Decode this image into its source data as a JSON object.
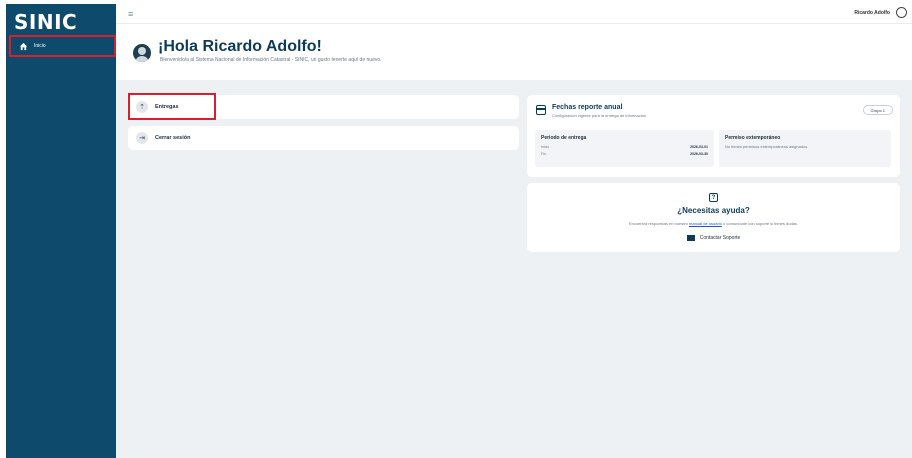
{
  "app": {
    "logo": "SINIC"
  },
  "sidebar": {
    "items": [
      {
        "label": "Inicio",
        "icon": "home-icon"
      }
    ]
  },
  "topbar": {
    "user_name": "Ricardo Adolfo"
  },
  "hero": {
    "greeting": "¡Hola Ricardo Adolfo!",
    "welcome": "Bienvenido/a al Sistema Nacional de Información Catastral - SINIC, un gusto tenerte aquí de nuevo."
  },
  "menu": {
    "items": [
      {
        "label": "Entregas",
        "icon": "upload-icon"
      },
      {
        "label": "Cerrar sesión",
        "icon": "logout-icon"
      }
    ]
  },
  "fechas": {
    "title": "Fechas reporte anual",
    "subtitle": "Configuración vigente para la entrega de información",
    "grupo_button": "Grupo 1",
    "periodo": {
      "title": "Periodo de entrega",
      "rows": [
        {
          "label": "Inicio",
          "value": "2026-03-01"
        },
        {
          "label": "Fin",
          "value": "2026-03-30"
        }
      ]
    },
    "permiso": {
      "title": "Permiso extemporáneo",
      "text": "No tienes permisos extemporáneos asignados."
    }
  },
  "ayuda": {
    "title": "¿Necesitas ayuda?",
    "text_before": "Encuentra respuestas en nuestro",
    "link": "manual de usuario",
    "text_after": "o comunícate con soporte si tienes dudas.",
    "contact": "Contactar Soporte"
  },
  "colors": {
    "sidebar": "#0d4a6b",
    "accent": "#0d3b57",
    "highlight": "#d9202a"
  }
}
